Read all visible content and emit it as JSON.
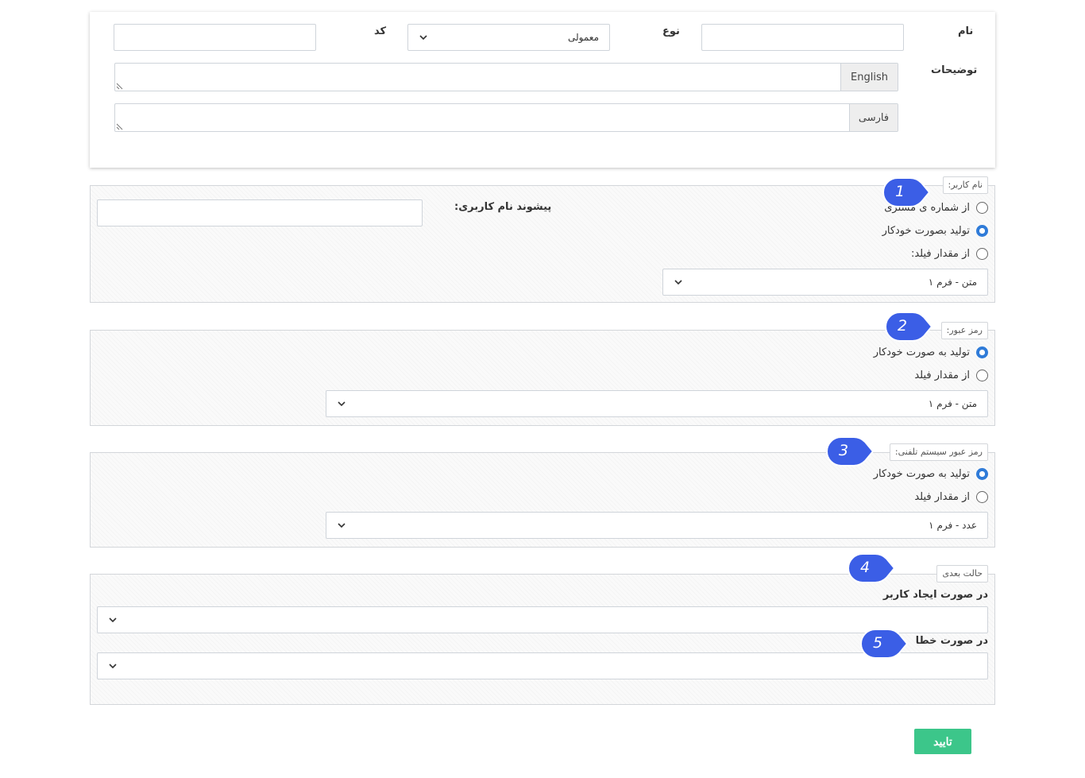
{
  "top": {
    "name_label": "نام",
    "type_label": "نوع",
    "type_value": "معمولی",
    "code_label": "کد",
    "desc_label": "توضیحات",
    "lang_en": "English",
    "lang_fa": "فارسی"
  },
  "username": {
    "legend": "نام کاربر:",
    "options": [
      "از شماره ی مشتری",
      "تولید بصورت خودکار",
      "از مقدار فیلد:"
    ],
    "selected": 1,
    "field_select": "متن - فرم ۱",
    "prefix_label": "پیشوند نام کاربری:"
  },
  "password": {
    "legend": "رمز عبور:",
    "options": [
      "تولید به صورت خودکار",
      "از مقدار فیلد"
    ],
    "selected": 0,
    "field_select": "متن - فرم ۱"
  },
  "phone_password": {
    "legend": "رمز عبور سیستم تلفنی:",
    "options": [
      "تولید به صورت خودکار",
      "از مقدار فیلد"
    ],
    "selected": 0,
    "field_select": "عدد - فرم ۱"
  },
  "next_state": {
    "legend": "حالت بعدی",
    "on_create_label": "در صورت ایجاد کاربر",
    "on_error_label": "در صورت خطا"
  },
  "callouts": [
    "1",
    "2",
    "3",
    "4",
    "5"
  ],
  "submit_label": "تایید",
  "colors": {
    "accent": "#2f7bd8",
    "callout": "#3b5ee6",
    "submit": "#3cc68a"
  }
}
